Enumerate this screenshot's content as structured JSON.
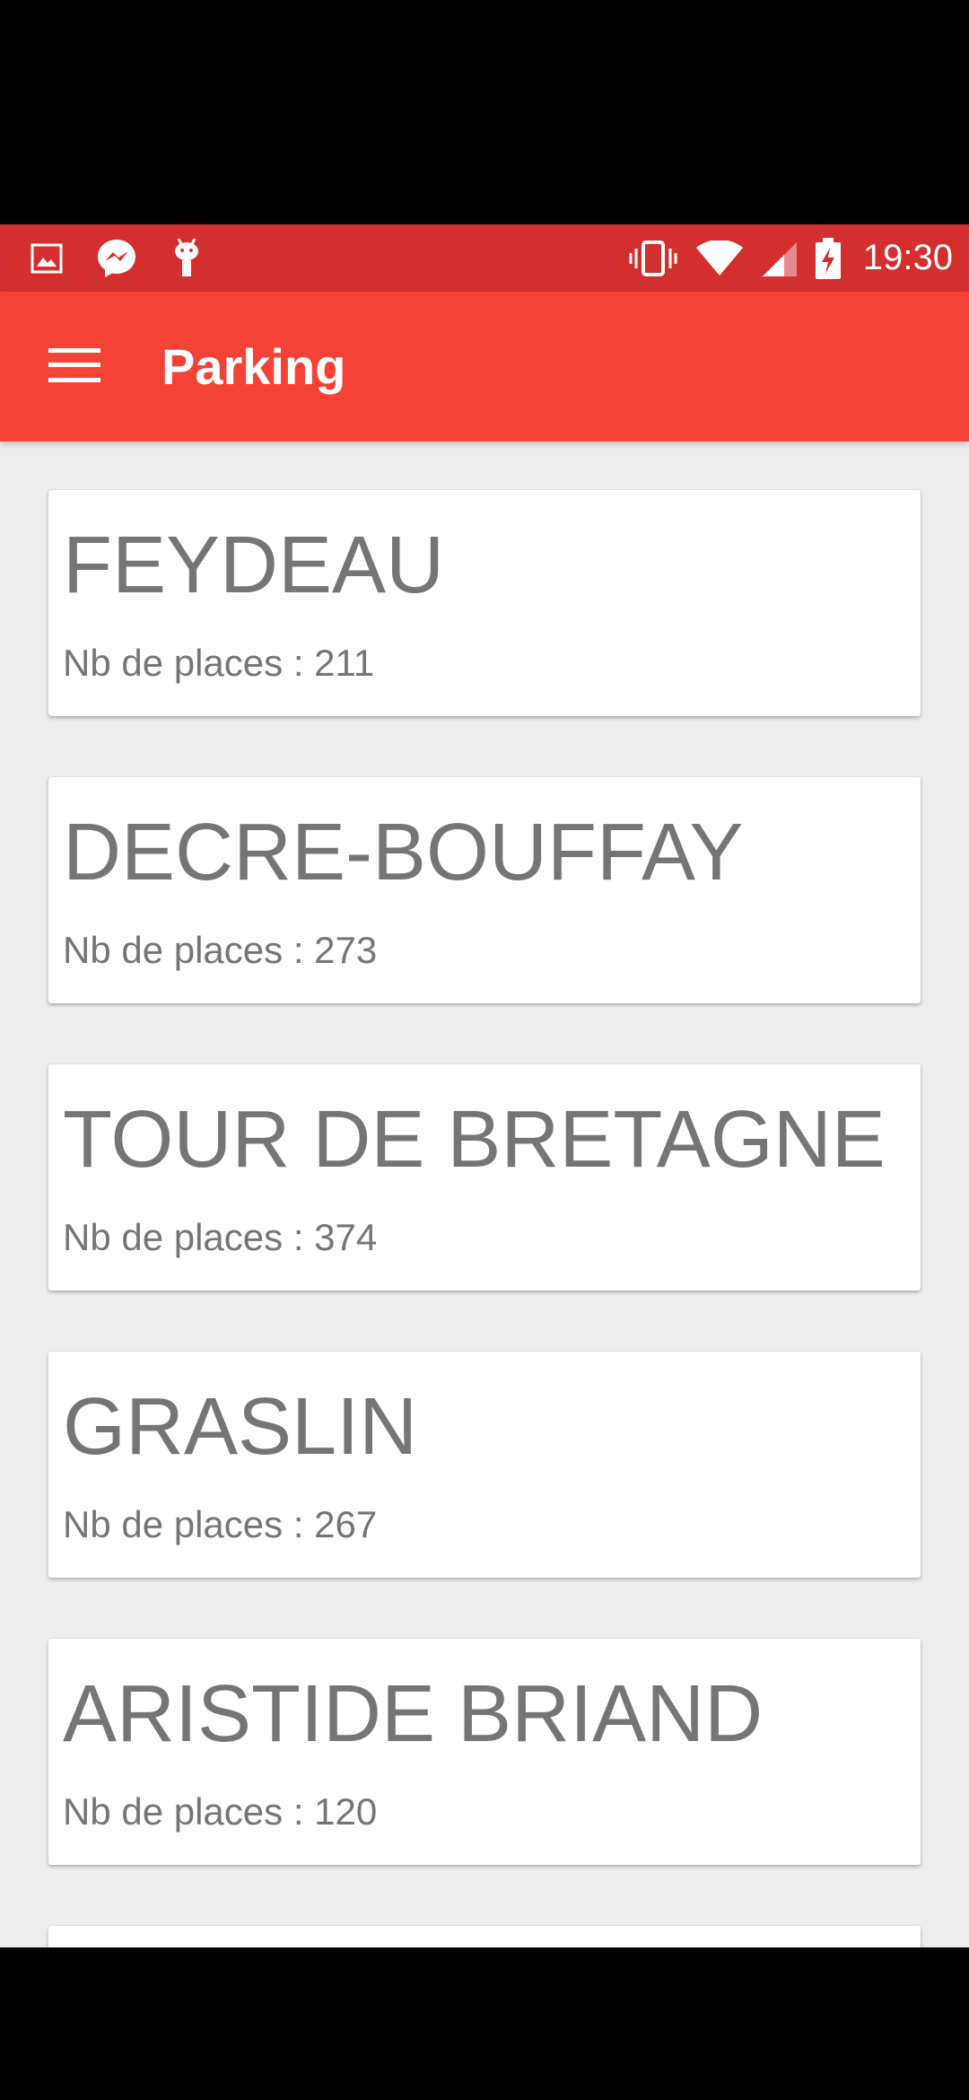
{
  "status_bar": {
    "time": "19:30",
    "left_icons": [
      "image-notification-icon",
      "messenger-icon",
      "android-debug-icon"
    ],
    "right_icons": [
      "vibrate-icon",
      "wifi-icon",
      "cell-signal-icon",
      "battery-charging-icon"
    ]
  },
  "app_bar": {
    "title": "Parking",
    "menu_icon": "hamburger-menu-icon"
  },
  "parkings": [
    {
      "name": "FEYDEAU",
      "places": "Nb de places : 211"
    },
    {
      "name": "DECRE-BOUFFAY",
      "places": "Nb de places : 273"
    },
    {
      "name": "TOUR DE BRETAGNE",
      "places": "Nb de places : 374"
    },
    {
      "name": "GRASLIN",
      "places": "Nb de places : 267"
    },
    {
      "name": "ARISTIDE BRIAND",
      "places": "Nb de places : 120"
    }
  ],
  "colors": {
    "status_bar": "#d32f2f",
    "app_bar": "#f44336",
    "background": "#eeeeee",
    "card": "#ffffff",
    "card_text": "#757575"
  }
}
